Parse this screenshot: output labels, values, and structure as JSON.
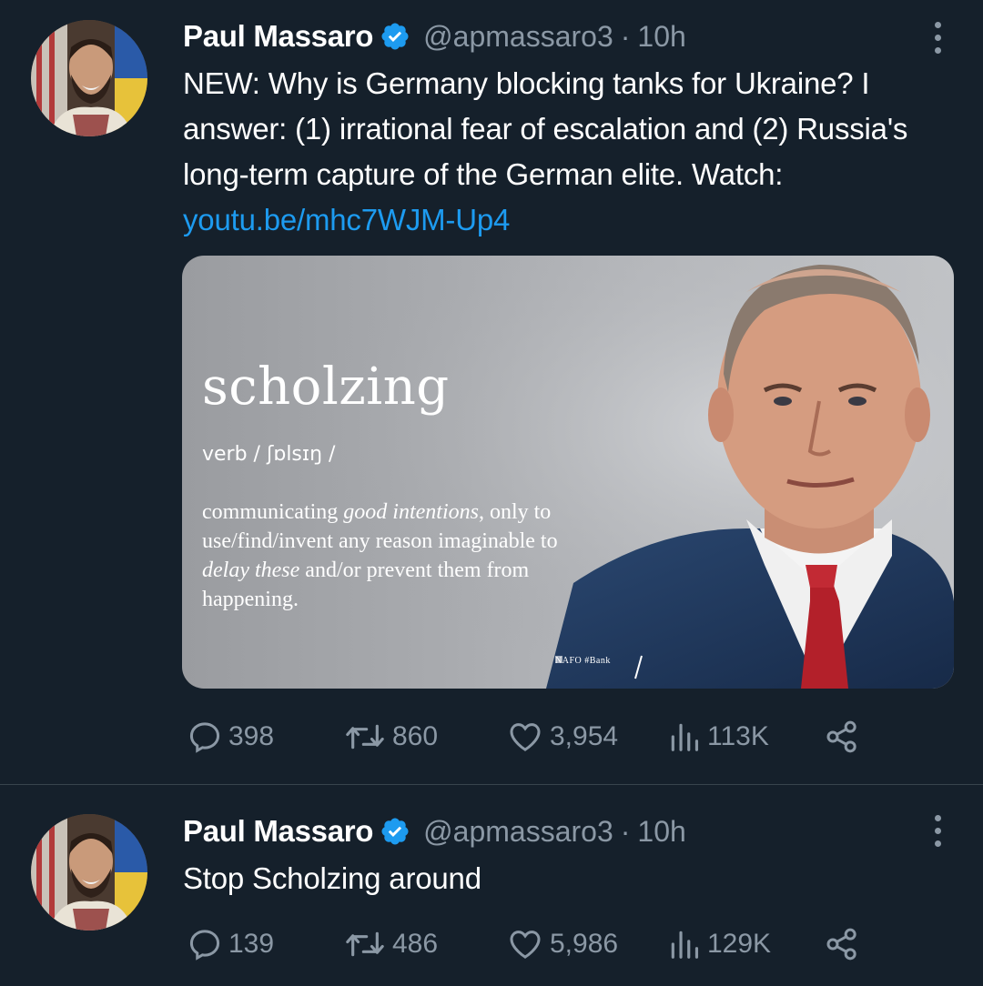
{
  "colors": {
    "background": "#15202b",
    "text": "#ffffff",
    "secondary_text": "#8b98a5",
    "link": "#1d9bf0",
    "verified": "#1d9bf0",
    "divider": "#38444d"
  },
  "tweets": [
    {
      "author": {
        "name": "Paul Massaro",
        "handle": "@apmassaro3",
        "verified": true,
        "avatar_icon": "avatar-photo"
      },
      "separator": "·",
      "time": "10h",
      "text": "NEW: Why is Germany blocking tanks for Ukraine? I answer: (1) irrational fear of escalation and (2) Russia's long-term capture of the German elite. Watch: ",
      "link": "youtu.be/mhc7WJM-Up4",
      "media": {
        "word": "scholzing",
        "part_of_speech": "verb / ʃɒlsɪŋ /",
        "definition_parts": [
          {
            "text": "communicating ",
            "italic": false
          },
          {
            "text": "good intentions",
            "italic": true
          },
          {
            "text": ", only to use/find/invent any reason imaginable to ",
            "italic": false
          },
          {
            "text": "delay these",
            "italic": true
          },
          {
            "text": " and/or prevent them from happening.",
            "italic": false
          }
        ],
        "watermark": "NAFO #Bank"
      },
      "stats": {
        "replies": "398",
        "retweets": "860",
        "likes": "3,954",
        "views": "113K"
      }
    },
    {
      "author": {
        "name": "Paul Massaro",
        "handle": "@apmassaro3",
        "verified": true,
        "avatar_icon": "avatar-photo"
      },
      "separator": "·",
      "time": "10h",
      "text": "Stop Scholzing around",
      "stats": {
        "replies": "139",
        "retweets": "486",
        "likes": "5,986",
        "views": "129K"
      }
    }
  ]
}
